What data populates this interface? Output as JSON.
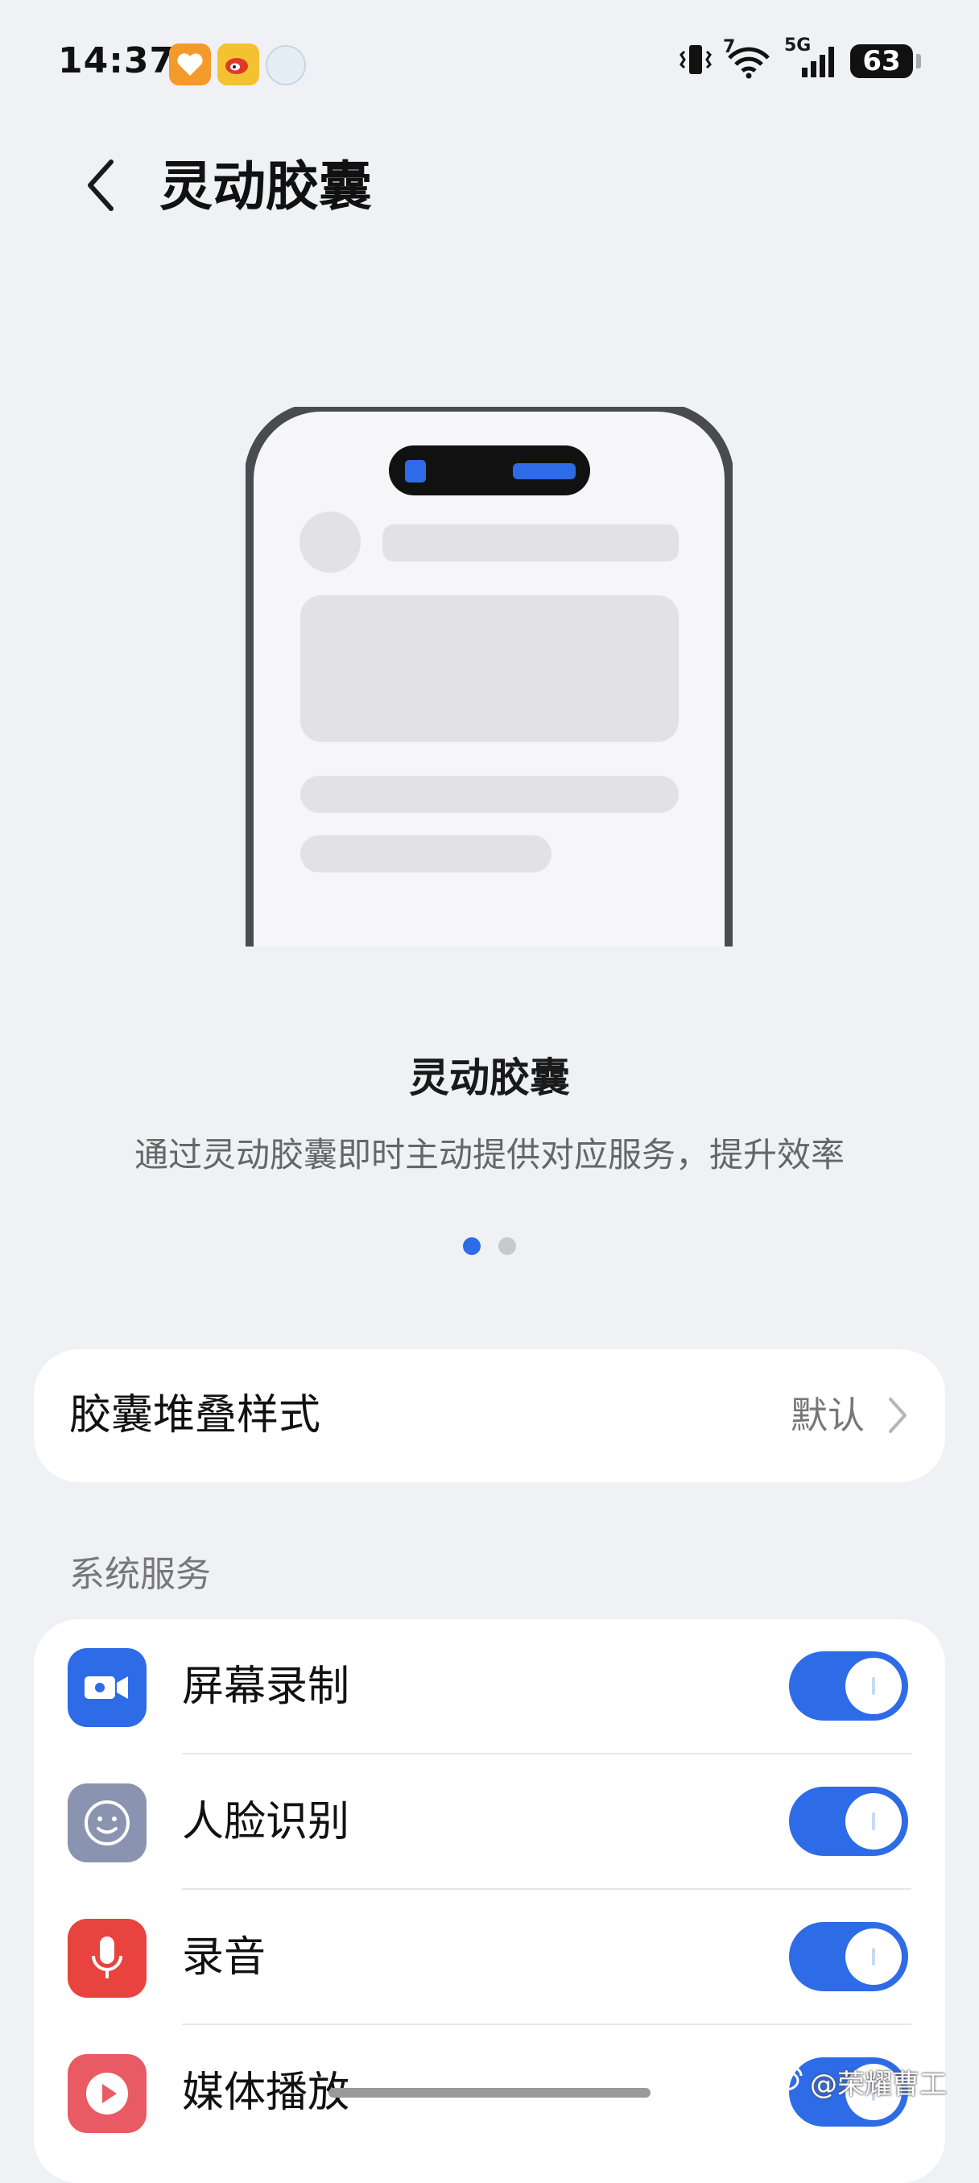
{
  "status_bar": {
    "time": "14:37",
    "signal_sim_label": "7",
    "network_label": "5G",
    "battery": "63",
    "notification_icons": [
      "heart-app-icon",
      "weibo-app-icon",
      "bubble-app-icon"
    ]
  },
  "header": {
    "title": "灵动胶囊",
    "back_icon": "chevron-left-icon"
  },
  "feature": {
    "title": "灵动胶囊",
    "description": "通过灵动胶囊即时主动提供对应服务，提升效率",
    "pager": {
      "count": 2,
      "active_index": 0
    }
  },
  "style_setting": {
    "label": "胶囊堆叠样式",
    "value": "默认"
  },
  "system_services": {
    "header": "系统服务",
    "items": [
      {
        "label": "屏幕录制",
        "icon": "video-camera-icon",
        "icon_color": "#2e6be6",
        "enabled": true
      },
      {
        "label": "人脸识别",
        "icon": "face-icon",
        "icon_color": "#8a93b0",
        "enabled": true
      },
      {
        "label": "录音",
        "icon": "microphone-icon",
        "icon_color": "#e8433e",
        "enabled": true
      },
      {
        "label": "媒体播放",
        "icon": "play-icon",
        "icon_color": "#e85a64",
        "enabled": true
      }
    ]
  },
  "watermark": {
    "text": "@荣耀曹工"
  },
  "colors": {
    "accent": "#2e6be6",
    "background": "#f0f1f5",
    "card": "#ffffff"
  }
}
